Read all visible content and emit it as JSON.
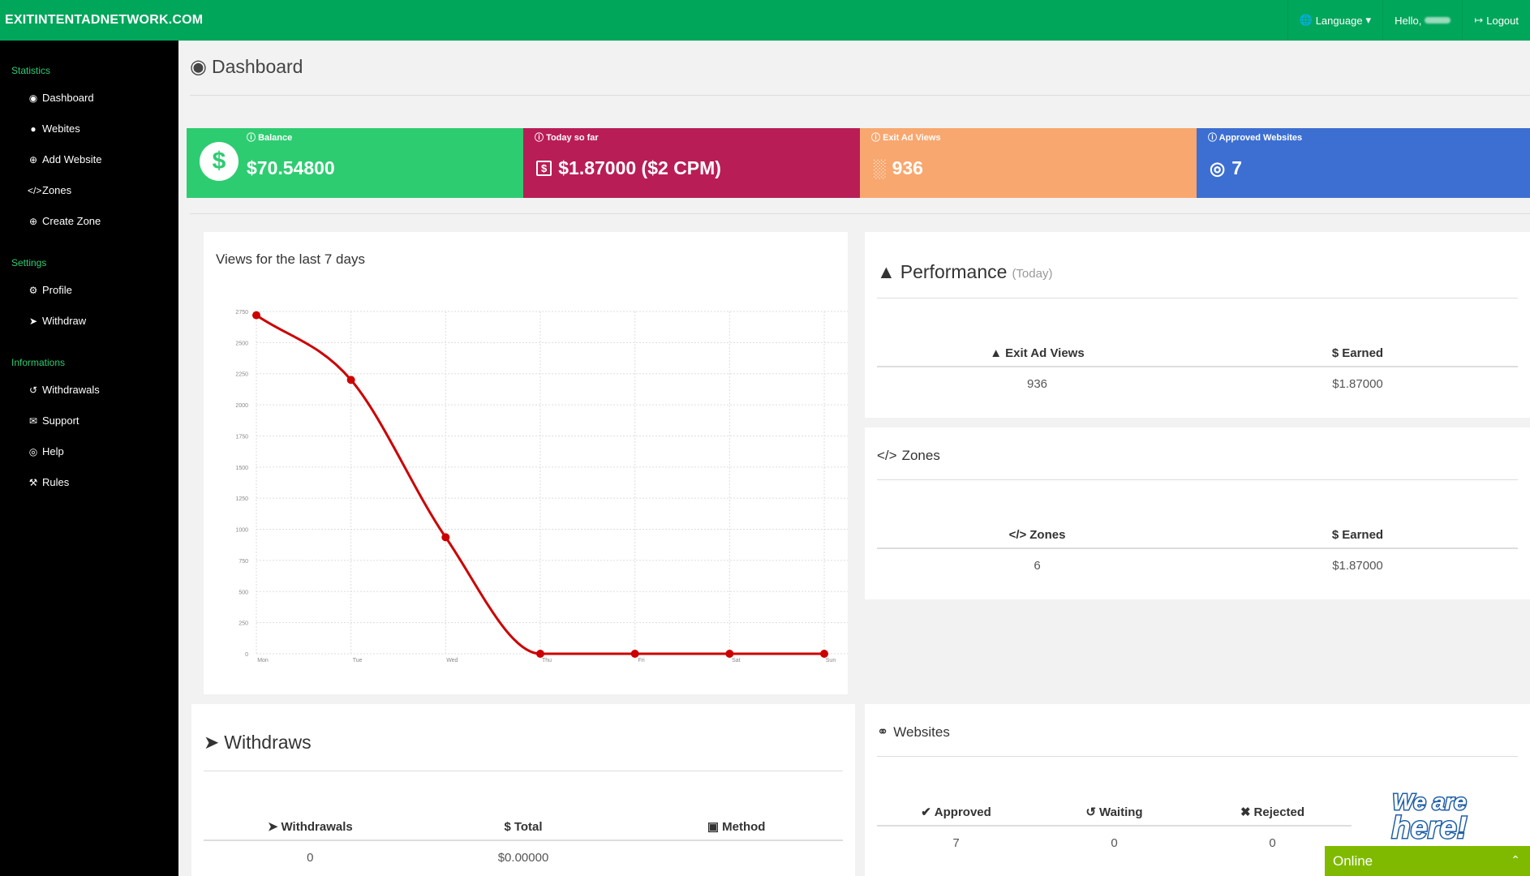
{
  "header": {
    "brand": "EXITINTENTADNETWORK.COM",
    "language": "Language",
    "hello": "Hello,",
    "logout": "Logout"
  },
  "sidebar": {
    "sections": [
      {
        "title": "Statistics",
        "items": [
          {
            "label": "Dashboard",
            "icon": "dashboard-icon"
          },
          {
            "label": "Webites",
            "icon": "globe-icon"
          },
          {
            "label": "Add Website",
            "icon": "plus-circle-icon"
          },
          {
            "label": "Zones",
            "icon": "code-icon"
          },
          {
            "label": "Create Zone",
            "icon": "plus-circle-icon"
          }
        ]
      },
      {
        "title": "Settings",
        "items": [
          {
            "label": "Profile",
            "icon": "gear-icon"
          },
          {
            "label": "Withdraw",
            "icon": "paper-plane-icon"
          }
        ]
      },
      {
        "title": "Informations",
        "items": [
          {
            "label": "Withdrawals",
            "icon": "history-icon"
          },
          {
            "label": "Support",
            "icon": "envelope-icon"
          },
          {
            "label": "Help",
            "icon": "lifebuoy-icon"
          },
          {
            "label": "Rules",
            "icon": "gavel-icon"
          }
        ]
      }
    ]
  },
  "page_title": "Dashboard",
  "stats": [
    {
      "label": "Balance",
      "value": "$70.54800",
      "color": "#2ecc71"
    },
    {
      "label": "Today so far",
      "value": "$1.87000 ($2 CPM)",
      "color": "#b91d56"
    },
    {
      "label": "Exit Ad Views",
      "value": "936",
      "color": "#f8a76f"
    },
    {
      "label": "Approved Websites",
      "value": "7",
      "color": "#3c6fd1"
    }
  ],
  "chart_card": {
    "title": "Views for the last 7 days"
  },
  "chart_data": {
    "type": "line",
    "categories": [
      "Mon",
      "Tue",
      "Wed",
      "Thu",
      "Fri",
      "Sat",
      "Sun"
    ],
    "values": [
      2720,
      2200,
      936,
      0,
      0,
      0,
      0
    ],
    "yticks": [
      0,
      250,
      500,
      750,
      1000,
      1250,
      1500,
      1750,
      2000,
      2250,
      2500,
      2750
    ],
    "ylim": [
      0,
      2750
    ],
    "grid": true,
    "color": "#cc0000"
  },
  "performance": {
    "title": "Performance",
    "subtitle": "(Today)",
    "columns": [
      "Exit Ad Views",
      "Earned"
    ],
    "row": [
      "936",
      "$1.87000"
    ]
  },
  "zones": {
    "title": "Zones",
    "columns": [
      "Zones",
      "Earned"
    ],
    "row": [
      "6",
      "$1.87000"
    ]
  },
  "withdraws": {
    "title": "Withdraws",
    "columns": [
      "Withdrawals",
      "Total",
      "Method"
    ],
    "row": [
      "0",
      "$0.00000",
      ""
    ]
  },
  "websites": {
    "title": "Websites",
    "columns": [
      "Approved",
      "Waiting",
      "Rejected"
    ],
    "row": [
      "7",
      "0",
      "0"
    ]
  },
  "chat": {
    "status": "Online",
    "badge": "We are here!"
  }
}
